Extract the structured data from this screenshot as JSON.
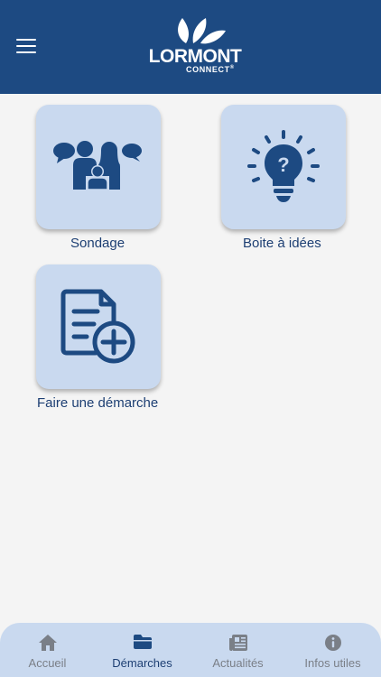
{
  "header": {
    "brand_main": "LORMONT",
    "brand_sub": "CONNECT",
    "brand_mark": "®",
    "background": "#1d4a82"
  },
  "tiles": [
    {
      "label": "Sondage",
      "icon": "people-chat-icon"
    },
    {
      "label": "Boite à idées",
      "icon": "lightbulb-question-icon"
    },
    {
      "label": "Faire une démarche",
      "icon": "document-add-icon"
    }
  ],
  "tabbar": {
    "items": [
      {
        "label": "Accueil",
        "icon": "home-icon",
        "active": false
      },
      {
        "label": "Démarches",
        "icon": "folder-icon",
        "active": true
      },
      {
        "label": "Actualités",
        "icon": "newspaper-icon",
        "active": false
      },
      {
        "label": "Infos utiles",
        "icon": "info-icon",
        "active": false
      }
    ]
  },
  "colors": {
    "accent": "#1d4a82",
    "tile_bg": "#c9d9ef",
    "icon": "#1d4a82",
    "inactive_tab": "#7a7f87"
  }
}
